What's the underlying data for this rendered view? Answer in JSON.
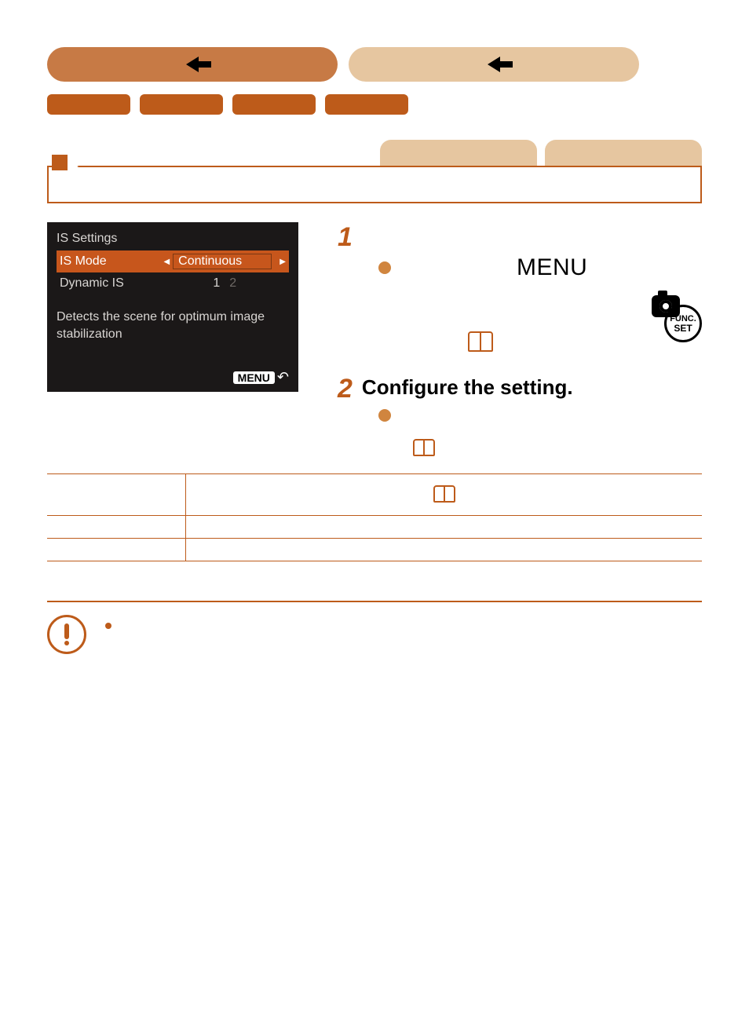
{
  "nav": {
    "back_dark": "",
    "back_light": ""
  },
  "tabs": [
    "",
    "",
    "",
    ""
  ],
  "right_tabs": [
    "",
    ""
  ],
  "camera_screen": {
    "title": "IS Settings",
    "rows": [
      {
        "label": "IS Mode",
        "value": "Continuous",
        "selected": true
      },
      {
        "label": "Dynamic IS",
        "value": "1",
        "dim": "2",
        "selected": false
      }
    ],
    "description": "Detects the scene for optimum image stabilization",
    "footer_button": "MENU"
  },
  "steps": [
    {
      "num": "1",
      "title": "",
      "menu_label": "MENU"
    },
    {
      "num": "2",
      "title": "Configure the setting."
    }
  ],
  "icon_func": {
    "top": "FUNC.",
    "bottom": "SET"
  },
  "table": {
    "rows": [
      {
        "mode": "",
        "desc": ""
      },
      {
        "mode": "",
        "desc": ""
      },
      {
        "mode": "",
        "desc": ""
      }
    ]
  },
  "warning": ""
}
